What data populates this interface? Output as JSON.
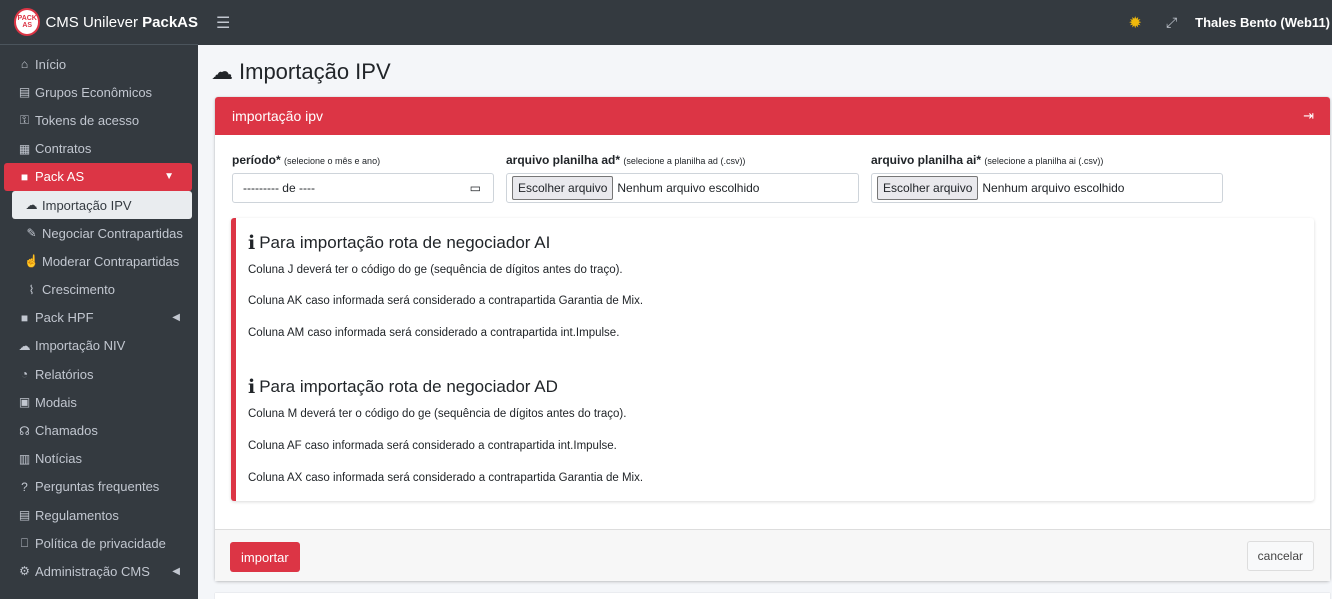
{
  "brand": {
    "logo_text": "PACK AS",
    "name_prefix": "CMS Unilever ",
    "name_bold": "PackAS"
  },
  "sidebar": {
    "items": [
      {
        "label": "Início",
        "icon": "home-icon"
      },
      {
        "label": "Grupos Econômicos",
        "icon": "store-icon"
      },
      {
        "label": "Tokens de acesso",
        "icon": "key-icon"
      },
      {
        "label": "Contratos",
        "icon": "file-icon"
      },
      {
        "label": "Pack AS",
        "icon": "folder-icon"
      },
      {
        "label": "Importação IPV",
        "icon": "cloud-upload-icon"
      },
      {
        "label": "Negociar Contrapartidas",
        "icon": "edit-icon"
      },
      {
        "label": "Moderar Contrapartidas",
        "icon": "thumbs-up-icon"
      },
      {
        "label": "Crescimento",
        "icon": "chart-line-icon"
      },
      {
        "label": "Pack HPF",
        "icon": "folder-icon"
      },
      {
        "label": "Importação NIV",
        "icon": "cloud-upload-icon"
      },
      {
        "label": "Relatórios",
        "icon": "pie-chart-icon"
      },
      {
        "label": "Modais",
        "icon": "inbox-icon"
      },
      {
        "label": "Chamados",
        "icon": "headset-icon"
      },
      {
        "label": "Notícias",
        "icon": "newspaper-icon"
      },
      {
        "label": "Perguntas frequentes",
        "icon": "question-icon"
      },
      {
        "label": "Regulamentos",
        "icon": "document-icon"
      },
      {
        "label": "Política de privacidade",
        "icon": "bookmark-icon"
      },
      {
        "label": "Administração CMS",
        "icon": "gears-icon"
      }
    ]
  },
  "topbar": {
    "user": "Thales Bento (Web11)"
  },
  "page": {
    "title": "Importação IPV"
  },
  "card": {
    "header": "importação ipv"
  },
  "form": {
    "periodo": {
      "label": "período*",
      "hint": "(selecione o mês e ano)",
      "value": "--------- de ----"
    },
    "ad": {
      "label": "arquivo planilha ad*",
      "hint": "(selecione a planilha ad (.csv))",
      "button": "Escolher arquivo",
      "status": "Nenhum arquivo escolhido"
    },
    "ai": {
      "label": "arquivo planilha ai*",
      "hint": "(selecione a planilha ai (.csv))",
      "button": "Escolher arquivo",
      "status": "Nenhum arquivo escolhido"
    }
  },
  "callout": {
    "ai": {
      "title": "Para importação rota de negociador AI",
      "lines": [
        "Coluna J deverá ter o código do ge (sequência de dígitos antes do traço).",
        "Coluna AK caso informada será considerado a contrapartida Garantia de Mix.",
        "Coluna AM caso informada será considerado a contrapartida int.Impulse."
      ]
    },
    "ad": {
      "title": "Para importação rota de negociador AD",
      "lines": [
        "Coluna M deverá ter o código do ge (sequência de dígitos antes do traço).",
        "Coluna AF caso informada será considerado a contrapartida int.Impulse.",
        "Coluna AX caso informada será considerado a contrapartida Garantia de Mix."
      ]
    }
  },
  "buttons": {
    "import": "importar",
    "cancel": "cancelar"
  },
  "colors": {
    "accent": "#dc3545",
    "sidebar": "#343a40"
  }
}
